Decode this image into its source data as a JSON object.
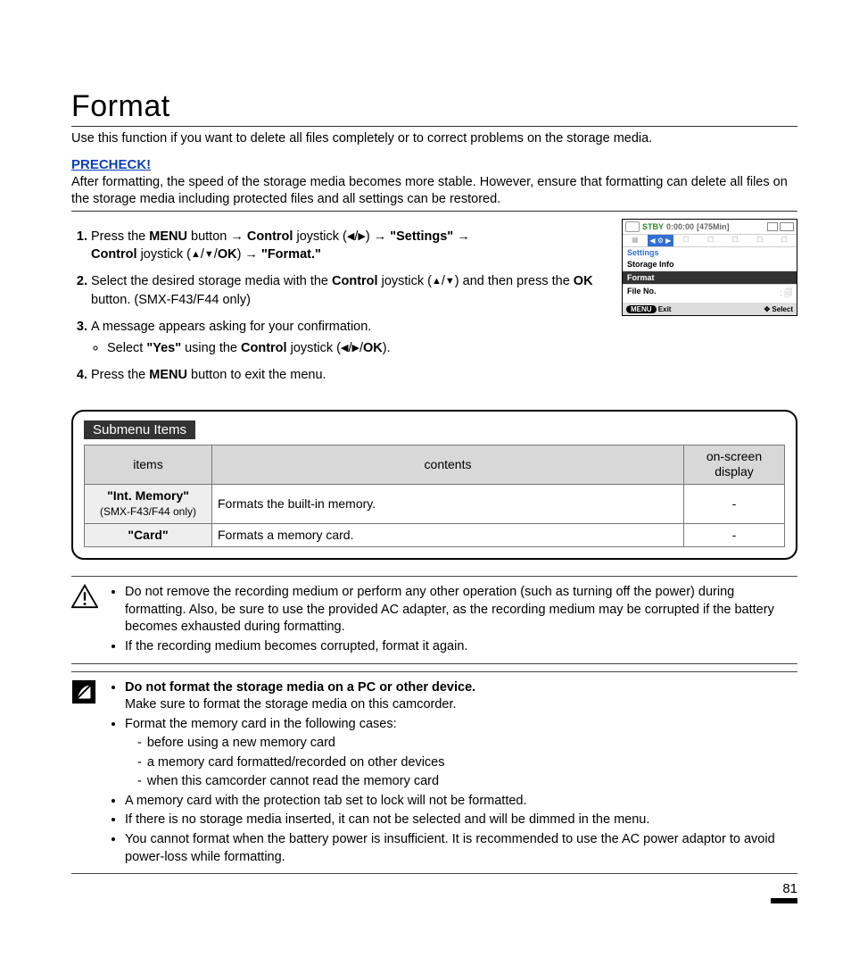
{
  "page": {
    "title": "Format",
    "intro": "Use this function if you want to delete all files completely or to correct problems on the storage media.",
    "precheck_label": "PRECHECK!",
    "after_text": "After formatting, the speed of the storage media becomes more stable. However, ensure that formatting can delete all files on the storage media including protected files and all settings can be restored.",
    "page_number": "81"
  },
  "steps": {
    "s1_a": "Press the ",
    "s1_menu": "MENU",
    "s1_b": " button ",
    "arr": "→",
    "s1_control": "Control",
    "s1_c": " joystick (",
    "tri_l": "◀",
    "tri_r": "▶",
    "tri_u": "▲",
    "tri_d": "▼",
    "ok": "OK",
    "s1_d": ") ",
    "s1_settings": "\"Settings\"",
    "s1_e": " joystick (",
    "s1_format": "\"Format.\"",
    "s2_a": "Select the desired storage media with the ",
    "s2_b": " joystick (",
    "s2_c": ") and then press the ",
    "s2_d": " button. (SMX-F43/F44 only)",
    "s3_a": "A message appears asking for your confirmation.",
    "s3_bullet_a": "Select ",
    "s3_yes": "\"Yes\"",
    "s3_bullet_b": " using the ",
    "s3_bullet_c": " joystick (",
    "s3_bullet_d": ").",
    "s4_a": "Press the ",
    "s4_b": " button to exit the menu."
  },
  "device": {
    "stby": "STBY",
    "time": "0:00:00",
    "mins": "[475Min]",
    "tab_label": "Settings",
    "items": [
      "Storage Info",
      "Format",
      "File No."
    ],
    "foot_menu": "MENU",
    "foot_exit": "Exit",
    "foot_select": "Select"
  },
  "submenu": {
    "label": "Submenu Items",
    "headers": {
      "items": "items",
      "contents": "contents",
      "osd": "on-screen display"
    },
    "rows": [
      {
        "item": "\"Int. Memory\"",
        "note": "(SMX-F43/F44 only)",
        "contents": "Formats the built-in memory.",
        "osd": "-"
      },
      {
        "item": "\"Card\"",
        "note": "",
        "contents": "Formats a memory card.",
        "osd": "-"
      }
    ]
  },
  "warn_box": {
    "b1": "Do not remove the recording medium or perform any other operation (such as turning off the power) during formatting. Also, be sure to use the provided AC adapter, as the recording medium may be corrupted if the battery becomes exhausted during formatting.",
    "b2": "If the recording medium becomes corrupted, format it again."
  },
  "note_box": {
    "b1_bold": "Do not format the storage media on a PC or other device.",
    "b1_sub": "Make sure to format the storage media on this camcorder.",
    "b2": "Format the memory card in the following cases:",
    "b2_d1": "before using a new memory card",
    "b2_d2": "a memory card formatted/recorded on other devices",
    "b2_d3": "when this camcorder cannot read the memory card",
    "b3": "A memory card with the protection tab set to lock will not be formatted.",
    "b4": "If there is no storage media inserted, it can not be selected and will be dimmed in the menu.",
    "b5": "You cannot format when the battery power is insufficient. It is recommended to use the AC power adaptor to avoid power-loss while formatting."
  }
}
